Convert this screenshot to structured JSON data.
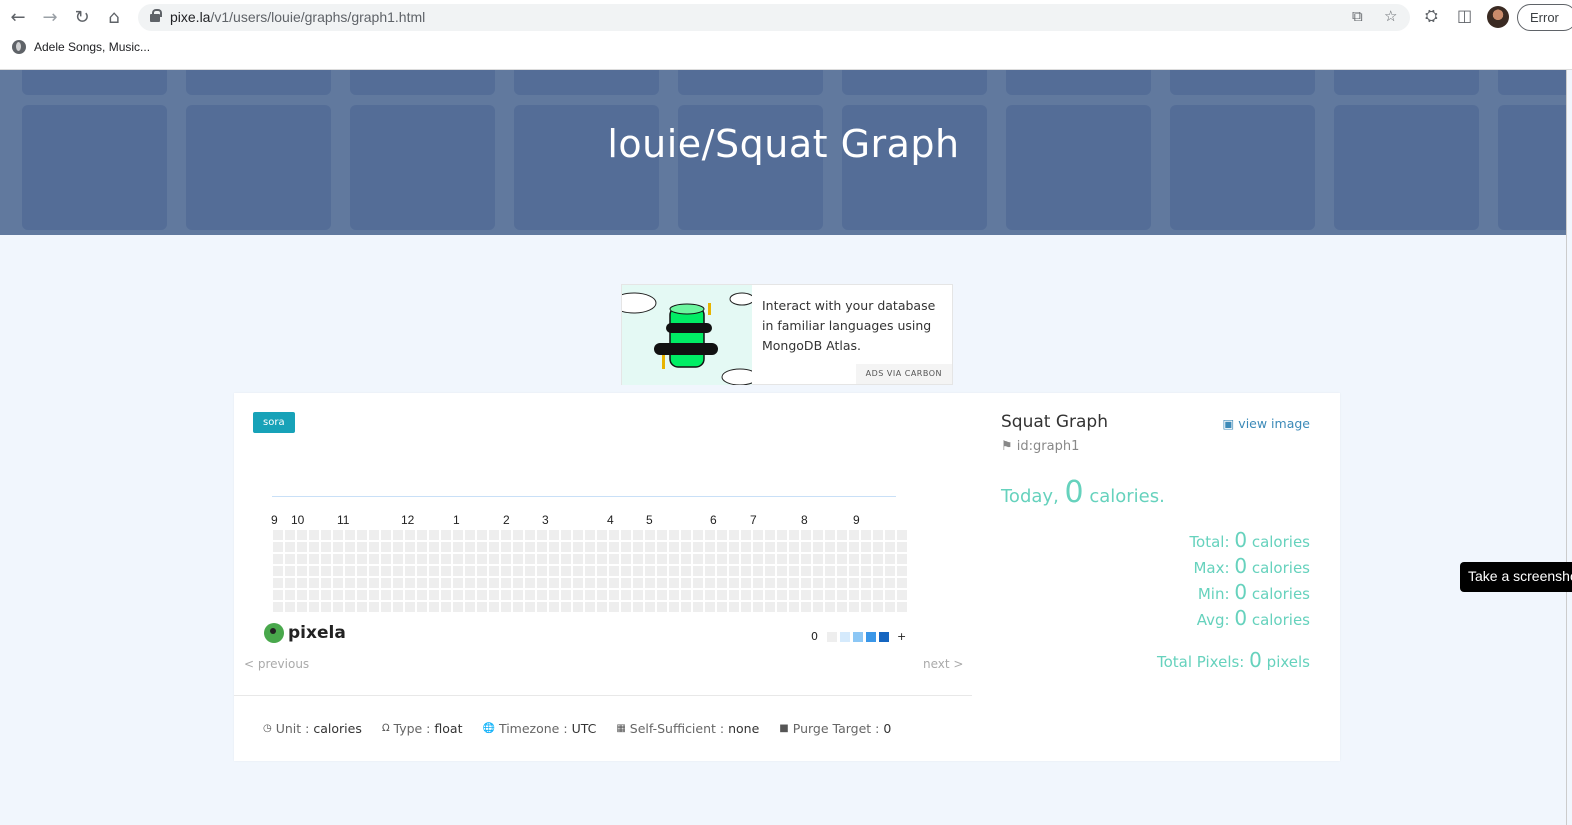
{
  "browser": {
    "url_domain": "pixe.la",
    "url_path": "/v1/users/louie/graphs/graph1.html",
    "error_label": "Error",
    "bookmark": "Adele Songs, Music..."
  },
  "hero": {
    "title": "louie/Squat Graph"
  },
  "ad": {
    "text": "Interact with your database in familiar languages using MongoDB Atlas.",
    "via": "ADS VIA CARBON"
  },
  "graph": {
    "tag": "sora",
    "months": [
      "9",
      "10",
      "11",
      "12",
      "1",
      "2",
      "3",
      "4",
      "5",
      "6",
      "7",
      "8",
      "9"
    ],
    "logo": "pixela",
    "legend_min": "0",
    "legend_max": "+",
    "legend_colors": [
      "#eeeeee",
      "#d5eafc",
      "#8cc7f5",
      "#3b97e8",
      "#1565c0"
    ],
    "prev": "< previous",
    "next": "next >"
  },
  "meta": {
    "unit_label": "Unit :",
    "unit": "calories",
    "type_label": "Type :",
    "type": "float",
    "timezone_label": "Timezone :",
    "timezone": "UTC",
    "self_label": "Self-Sufficient :",
    "self": "none",
    "purge_label": "Purge Target :",
    "purge": "0"
  },
  "side": {
    "title": "Squat Graph",
    "id": "id:graph1",
    "view_image": "view image",
    "today_label": "Today",
    "today_value": "0",
    "today_unit": "calories.",
    "total_label": "Total:",
    "total": "0",
    "max_label": "Max:",
    "max": "0",
    "min_label": "Min:",
    "min": "0",
    "avg_label": "Avg:",
    "avg": "0",
    "unit": "calories",
    "pixels_label": "Total Pixels:",
    "pixels": "0",
    "pixels_unit": "pixels"
  },
  "tooltip": "Take a screensho"
}
